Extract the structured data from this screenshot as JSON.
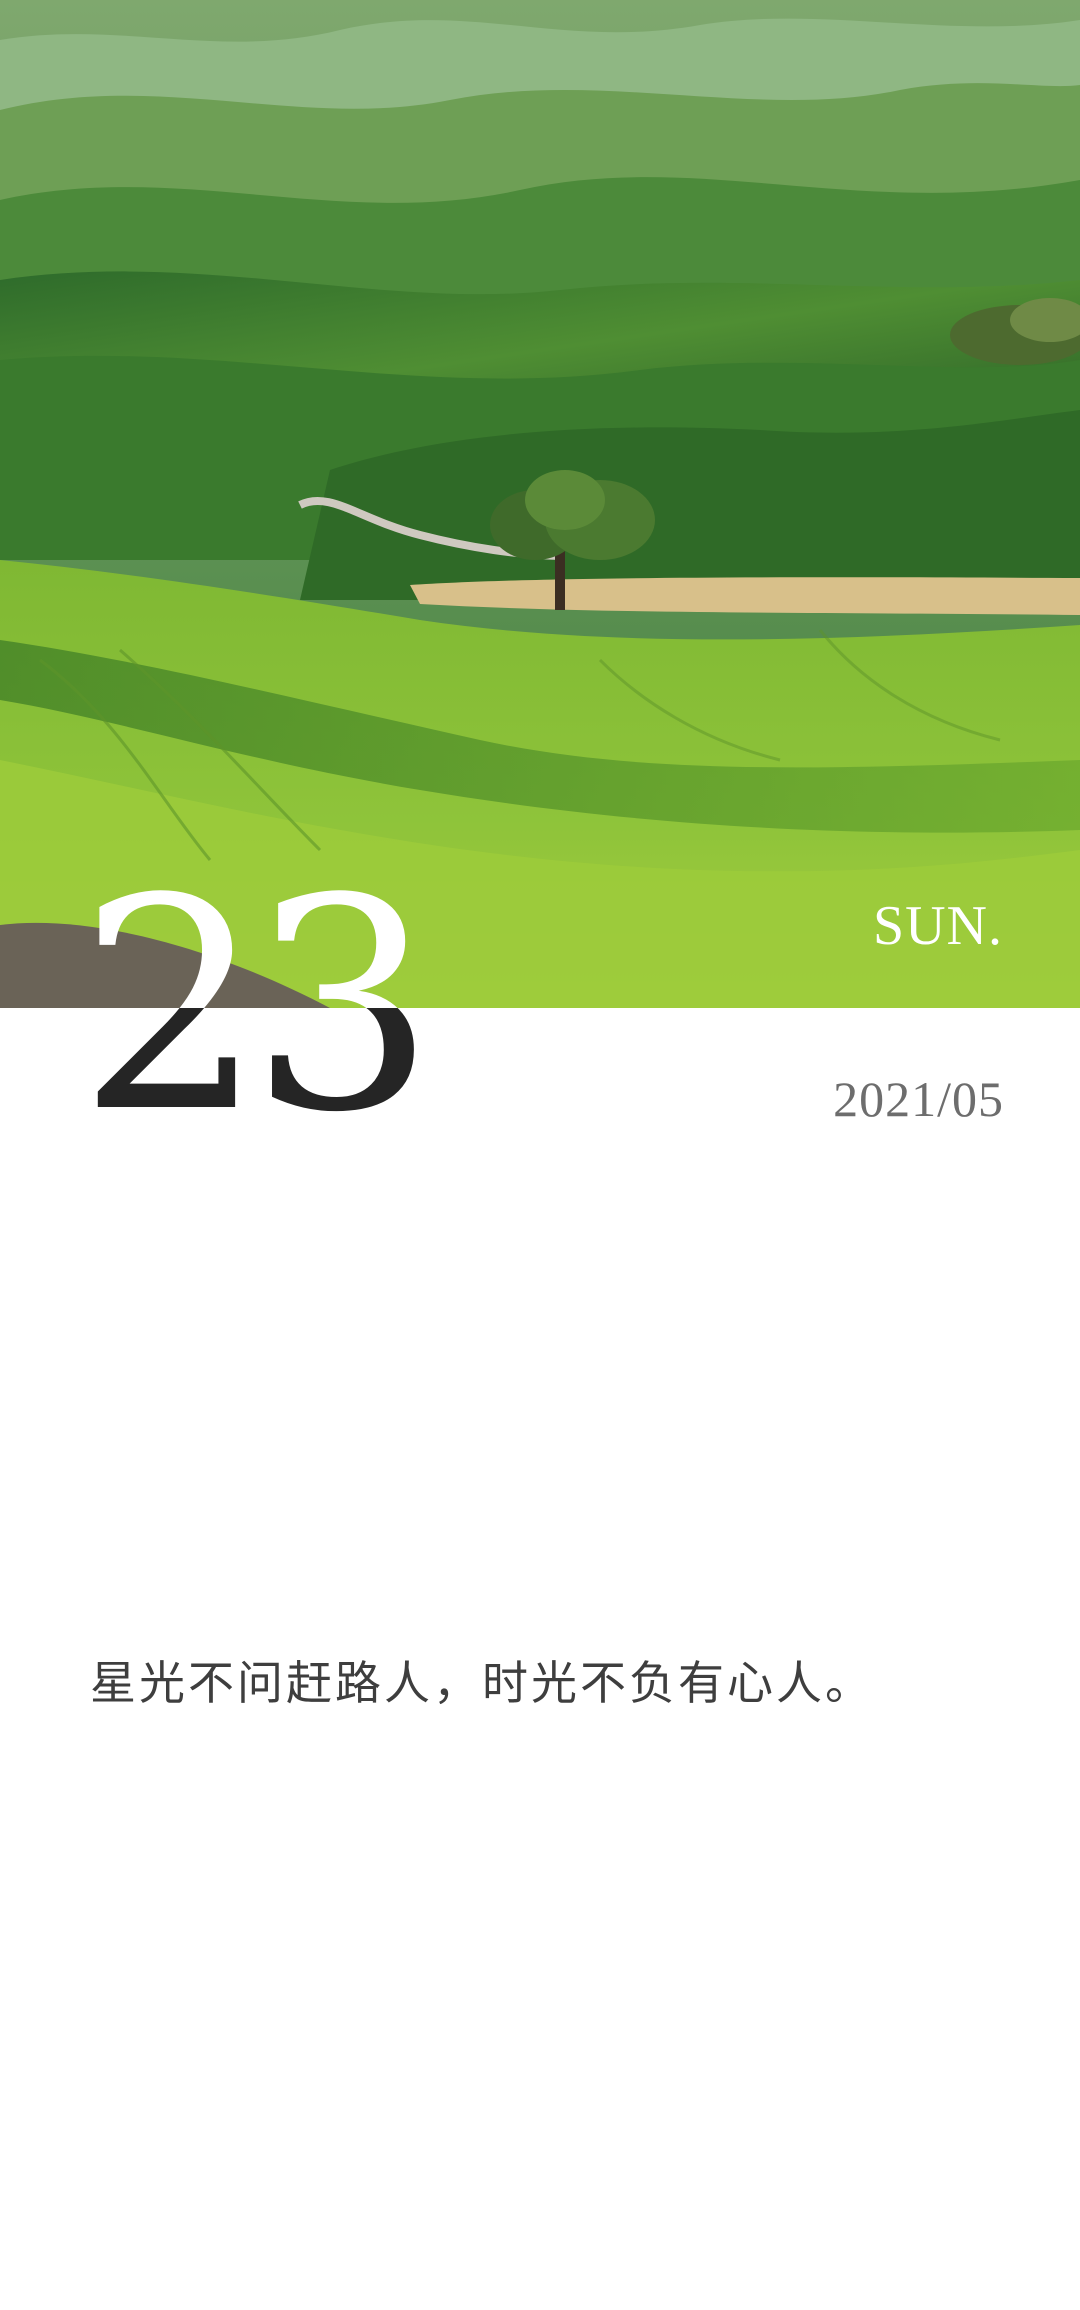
{
  "hero": {
    "image_icon": "rolling-green-hills-photo"
  },
  "date": {
    "day": "23",
    "weekday": "SUN.",
    "year_month": "2021/05"
  },
  "quote": {
    "text": "星光不问赶路人，时光不负有心人。"
  },
  "colors": {
    "day_number_lower": "#252525",
    "year_month": "#6d6d6d",
    "quote_text": "#3e3e3e",
    "hills_dark": "#2f6e2a",
    "hills_light": "#9cc83a"
  }
}
